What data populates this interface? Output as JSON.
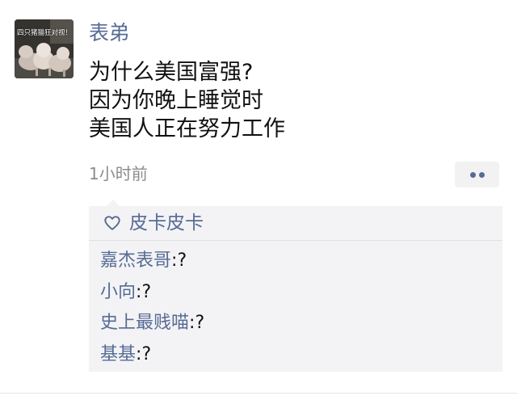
{
  "post": {
    "author": "表弟",
    "avatar_caption": "四只猪猫狂对视！",
    "avatar_icon": "pig-photo-avatar",
    "lines": [
      "为什么美国富强?",
      "因为你晚上睡觉时",
      "美国人正在努力工作"
    ],
    "timestamp": "1小时前",
    "more_icon": "two-dots-more-icon"
  },
  "likes": {
    "icon": "heart-outline-icon",
    "names": "皮卡皮卡"
  },
  "comments": [
    {
      "user": "嘉杰表哥",
      "sep": ":",
      "text": "?"
    },
    {
      "user": "小向",
      "sep": ":",
      "text": "?"
    },
    {
      "user": "史上最贱喵",
      "sep": ":",
      "text": "?"
    },
    {
      "user": "基基",
      "sep": ":",
      "text": "?"
    }
  ],
  "colors": {
    "link": "#576b95",
    "text": "#111111",
    "meta": "#8c8c8c",
    "comment_bg": "#f3f3f5"
  }
}
